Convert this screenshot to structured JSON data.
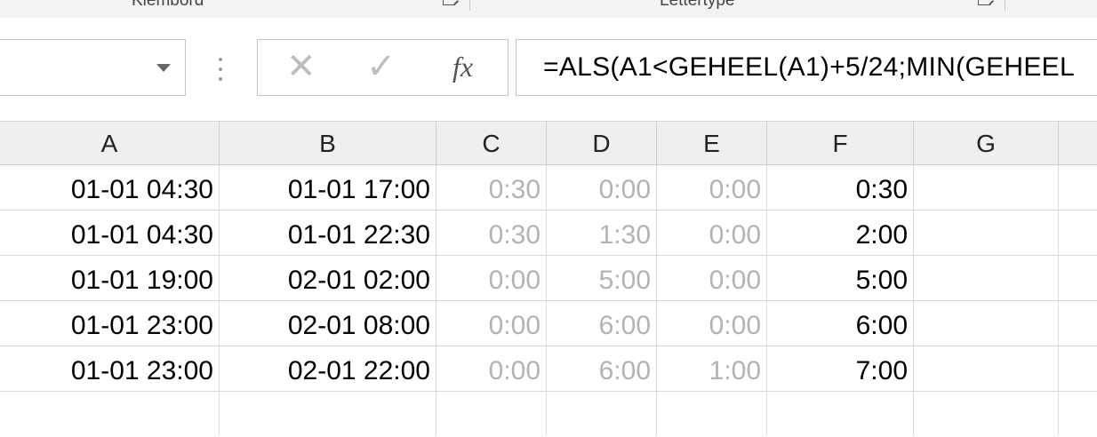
{
  "ribbon": {
    "groups": [
      {
        "label": "Klembord"
      },
      {
        "label": "Lettertype"
      }
    ]
  },
  "formula_bar": {
    "name_box_value": "",
    "cancel_symbol": "✕",
    "enter_symbol": "✓",
    "fx_label": "fx",
    "formula": "=ALS(A1<GEHEEL(A1)+5/24;MIN(GEHEEL"
  },
  "columns": [
    "A",
    "B",
    "C",
    "D",
    "E",
    "F",
    "G"
  ],
  "rows": [
    [
      "01-01 04:30",
      "01-01 17:00",
      "0:30",
      "0:00",
      "0:00",
      "0:30",
      ""
    ],
    [
      "01-01 04:30",
      "01-01 22:30",
      "0:30",
      "1:30",
      "0:00",
      "2:00",
      ""
    ],
    [
      "01-01 19:00",
      "02-01 02:00",
      "0:00",
      "5:00",
      "0:00",
      "5:00",
      ""
    ],
    [
      "01-01 23:00",
      "02-01 08:00",
      "0:00",
      "6:00",
      "0:00",
      "6:00",
      ""
    ],
    [
      "01-01 23:00",
      "02-01 22:00",
      "0:00",
      "6:00",
      "1:00",
      "7:00",
      ""
    ],
    [
      "",
      "",
      "",
      "",
      "",
      "",
      ""
    ]
  ],
  "colors": {
    "accent": "#217346",
    "gray_value": "#b3b3b3",
    "grid_line": "#d9d9d9"
  }
}
